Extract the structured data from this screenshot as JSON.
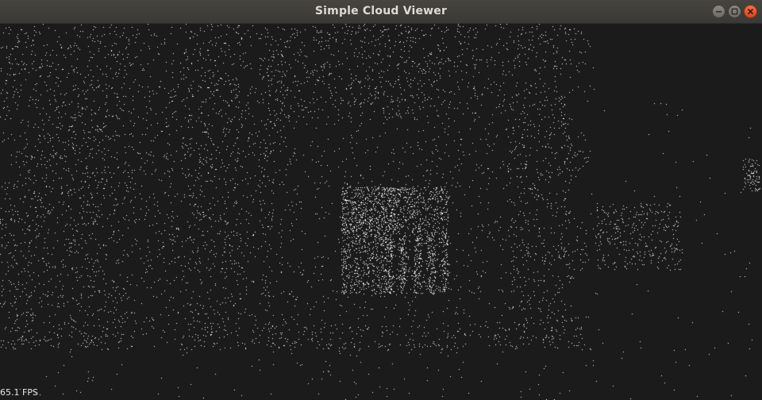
{
  "window": {
    "title": "Simple Cloud Viewer",
    "buttons": {
      "minimize_icon": "minimize-icon",
      "maximize_icon": "maximize-icon",
      "close_icon": "close-icon"
    }
  },
  "viewer": {
    "fps_label": "65.1 FPS",
    "background_color": "#1b1b1b",
    "point_color": "#ffffff"
  }
}
